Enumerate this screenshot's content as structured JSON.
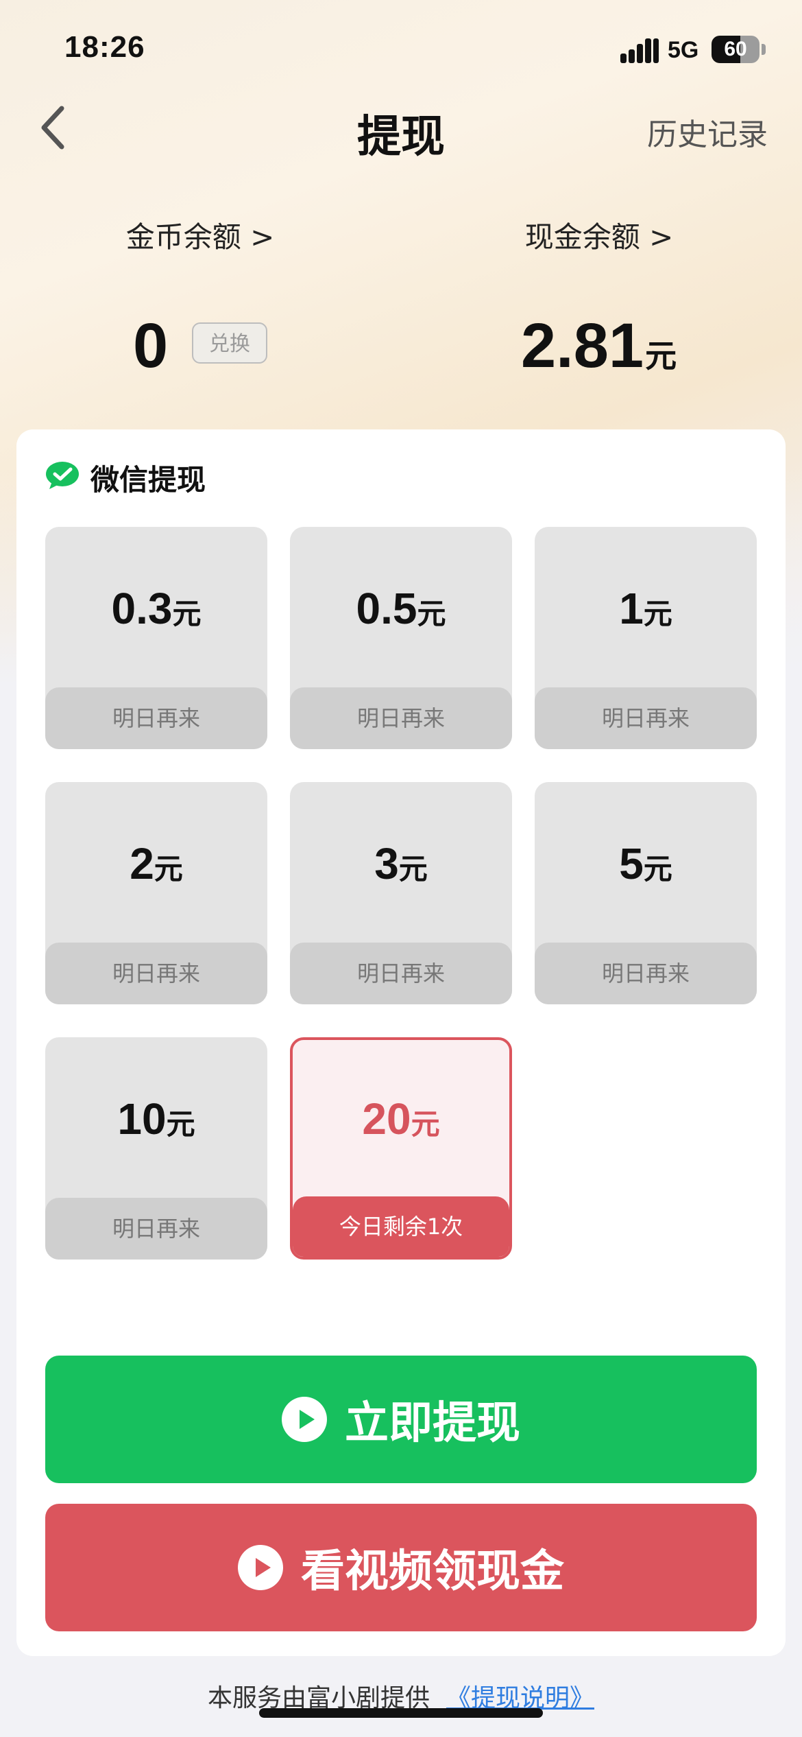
{
  "status_bar": {
    "time": "18:26",
    "network": "5G",
    "battery": "60"
  },
  "header": {
    "title": "提现",
    "history": "历史记录"
  },
  "balances": {
    "coin_label": "金币余额 >",
    "coin_value": "0",
    "exchange_label": "兑换",
    "cash_label": "现金余额 >",
    "cash_value": "2.81",
    "cash_unit": "元"
  },
  "wechat": {
    "title": "微信提现",
    "options": [
      {
        "amount": "0.3",
        "unit": "元",
        "status": "明日再来"
      },
      {
        "amount": "0.5",
        "unit": "元",
        "status": "明日再来"
      },
      {
        "amount": "1",
        "unit": "元",
        "status": "明日再来"
      },
      {
        "amount": "2",
        "unit": "元",
        "status": "明日再来"
      },
      {
        "amount": "3",
        "unit": "元",
        "status": "明日再来"
      },
      {
        "amount": "5",
        "unit": "元",
        "status": "明日再来"
      },
      {
        "amount": "10",
        "unit": "元",
        "status": "明日再来"
      },
      {
        "amount": "20",
        "unit": "元",
        "status": "今日剩余1次"
      }
    ]
  },
  "actions": {
    "withdraw": "立即提现",
    "watch_video": "看视频领现金"
  },
  "footer": {
    "text": "本服务由富小剧提供",
    "link": "《提现说明》"
  },
  "colors": {
    "green": "#17c05e",
    "red": "#db555d"
  }
}
